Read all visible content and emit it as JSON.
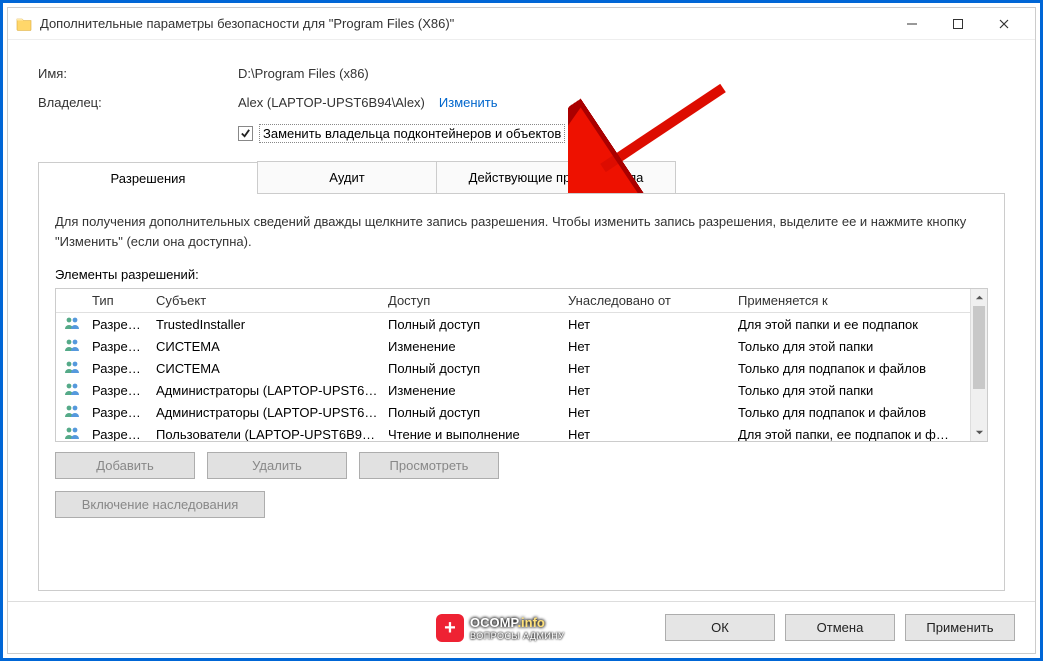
{
  "window": {
    "title": "Дополнительные параметры безопасности  для \"Program Files (X86)\""
  },
  "fields": {
    "name_label": "Имя:",
    "name_value": "D:\\Program Files (x86)",
    "owner_label": "Владелец:",
    "owner_value": "Alex (LAPTOP-UPST6B94\\Alex)",
    "change_link": "Изменить",
    "replace_owner_checkbox": "Заменить владельца подконтейнеров и объектов"
  },
  "tabs": {
    "permissions": "Разрешения",
    "audit": "Аудит",
    "effective": "Действующие права доступа"
  },
  "permissions_tab": {
    "help": "Для получения дополнительных сведений дважды щелкните запись разрешения. Чтобы изменить запись разрешения, выделите ее и нажмите кнопку \"Изменить\" (если она доступна).",
    "list_caption": "Элементы разрешений:",
    "columns": {
      "type": "Тип",
      "subject": "Субъект",
      "access": "Доступ",
      "inherited": "Унаследовано от",
      "applies": "Применяется к"
    },
    "rows": [
      {
        "type": "Разре…",
        "subject": "TrustedInstaller",
        "access": "Полный доступ",
        "inherited": "Нет",
        "applies": "Для этой папки и ее подпапок"
      },
      {
        "type": "Разре…",
        "subject": "СИСТЕМА",
        "access": "Изменение",
        "inherited": "Нет",
        "applies": "Только для этой папки"
      },
      {
        "type": "Разре…",
        "subject": "СИСТЕМА",
        "access": "Полный доступ",
        "inherited": "Нет",
        "applies": "Только для подпапок и файлов"
      },
      {
        "type": "Разре…",
        "subject": "Администраторы (LAPTOP-UPST6…",
        "access": "Изменение",
        "inherited": "Нет",
        "applies": "Только для этой папки"
      },
      {
        "type": "Разре…",
        "subject": "Администраторы (LAPTOP-UPST6…",
        "access": "Полный доступ",
        "inherited": "Нет",
        "applies": "Только для подпапок и файлов"
      },
      {
        "type": "Разре…",
        "subject": "Пользователи (LAPTOP-UPST6B9…",
        "access": "Чтение и выполнение",
        "inherited": "Нет",
        "applies": "Для этой папки, ее подпапок и ф…"
      }
    ],
    "buttons": {
      "add": "Добавить",
      "remove": "Удалить",
      "view": "Просмотреть",
      "enable_inheritance": "Включение наследования"
    }
  },
  "footer": {
    "ok": "ОК",
    "cancel": "Отмена",
    "apply": "Применить"
  },
  "watermark": {
    "main": "OCOMP",
    "suffix": ".info",
    "sub": "ВОПРОСЫ АДМИНУ"
  }
}
